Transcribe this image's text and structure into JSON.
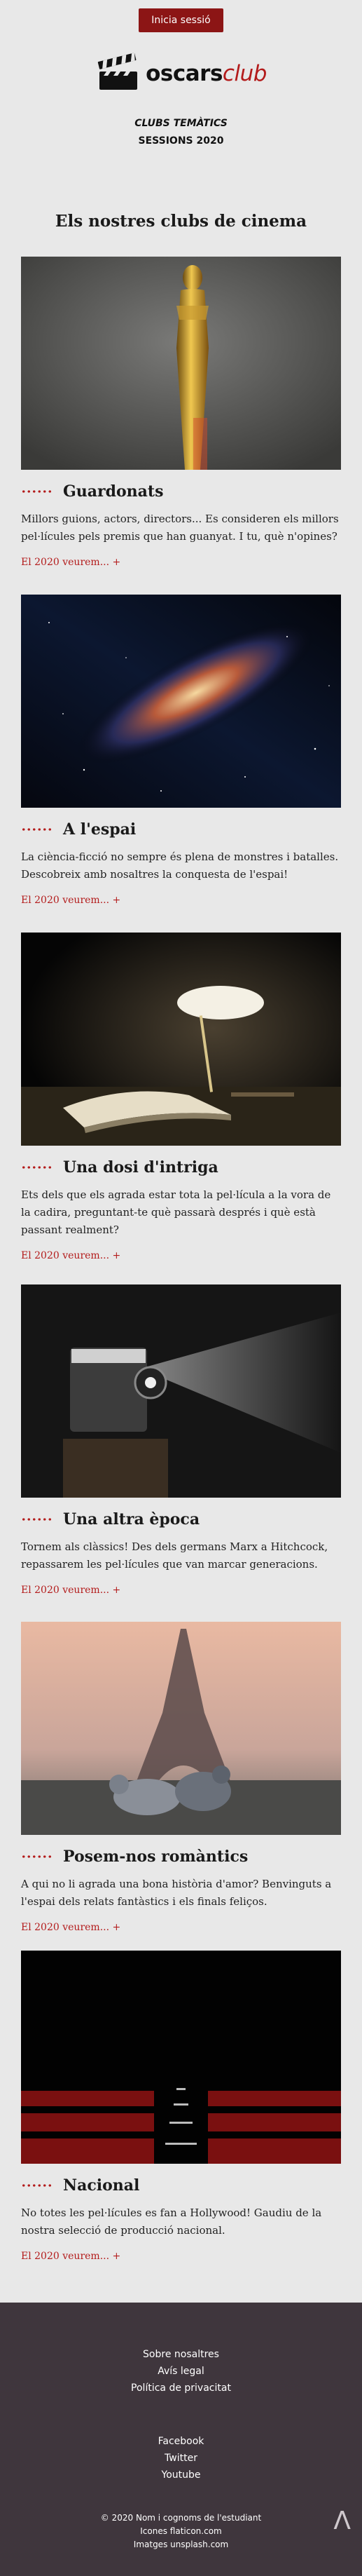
{
  "header": {
    "login_label": "Inicia sessió",
    "logo_word1": "oscars",
    "logo_word2": "club",
    "tagline_line1": "CLUBS TEMÀTICS",
    "tagline_line2": "SESSIONS 2020"
  },
  "main": {
    "title": "Els nostres clubs de cinema",
    "link_label": "El 2020 veurem... +",
    "clubs": [
      {
        "title": "Guardonats",
        "desc": "Millors guions, actors, directors... Es consideren els millors pel·lícules pels premis que han guanyat. I tu, què n'opines?",
        "image": "oscar-statue"
      },
      {
        "title": "A l'espai",
        "desc": "La ciència-ficció no sempre és plena de monstres i batalles. Descobreix amb nosaltres la conquesta de l'espai!",
        "image": "milky-way"
      },
      {
        "title": "Una dosi d'intriga",
        "desc": "Ets dels que els agrada estar tota la pel·lícula a la vora de la cadira, preguntant-te què passarà després i què està passant realment?",
        "image": "lamp-and-book"
      },
      {
        "title": "Una altra època",
        "desc": "Tornem als clàssics! Des dels germans Marx a Hitchcock, repassarem les pel·lícules que van marcar generacions.",
        "image": "film-projector"
      },
      {
        "title": "Posem-nos romàntics",
        "desc": "A qui no li agrada una bona història d'amor? Benvinguts a l'espai dels relats fantàstics i els finals feliços.",
        "image": "eiffel-pigeons"
      },
      {
        "title": "Nacional",
        "desc": "No totes les pel·lícules es fan a Hollywood! Gaudiu de la nostra selecció de producció nacional.",
        "image": "cinema-seats"
      }
    ]
  },
  "footer": {
    "links": [
      "Sobre nosaltres",
      "Avís legal",
      "Política de privacitat"
    ],
    "social": [
      "Facebook",
      "Twitter",
      "Youtube"
    ],
    "meta": [
      "© 2020 Nom i cognoms de l'estudiant",
      "Icones flaticon.com",
      "Imatges unsplash.com"
    ],
    "back_top_icon": "caret-up-icon"
  },
  "colors": {
    "accent": "#b31b1b",
    "button": "#8c1515",
    "background": "#e8e8e8",
    "footer": "#3f363d"
  }
}
